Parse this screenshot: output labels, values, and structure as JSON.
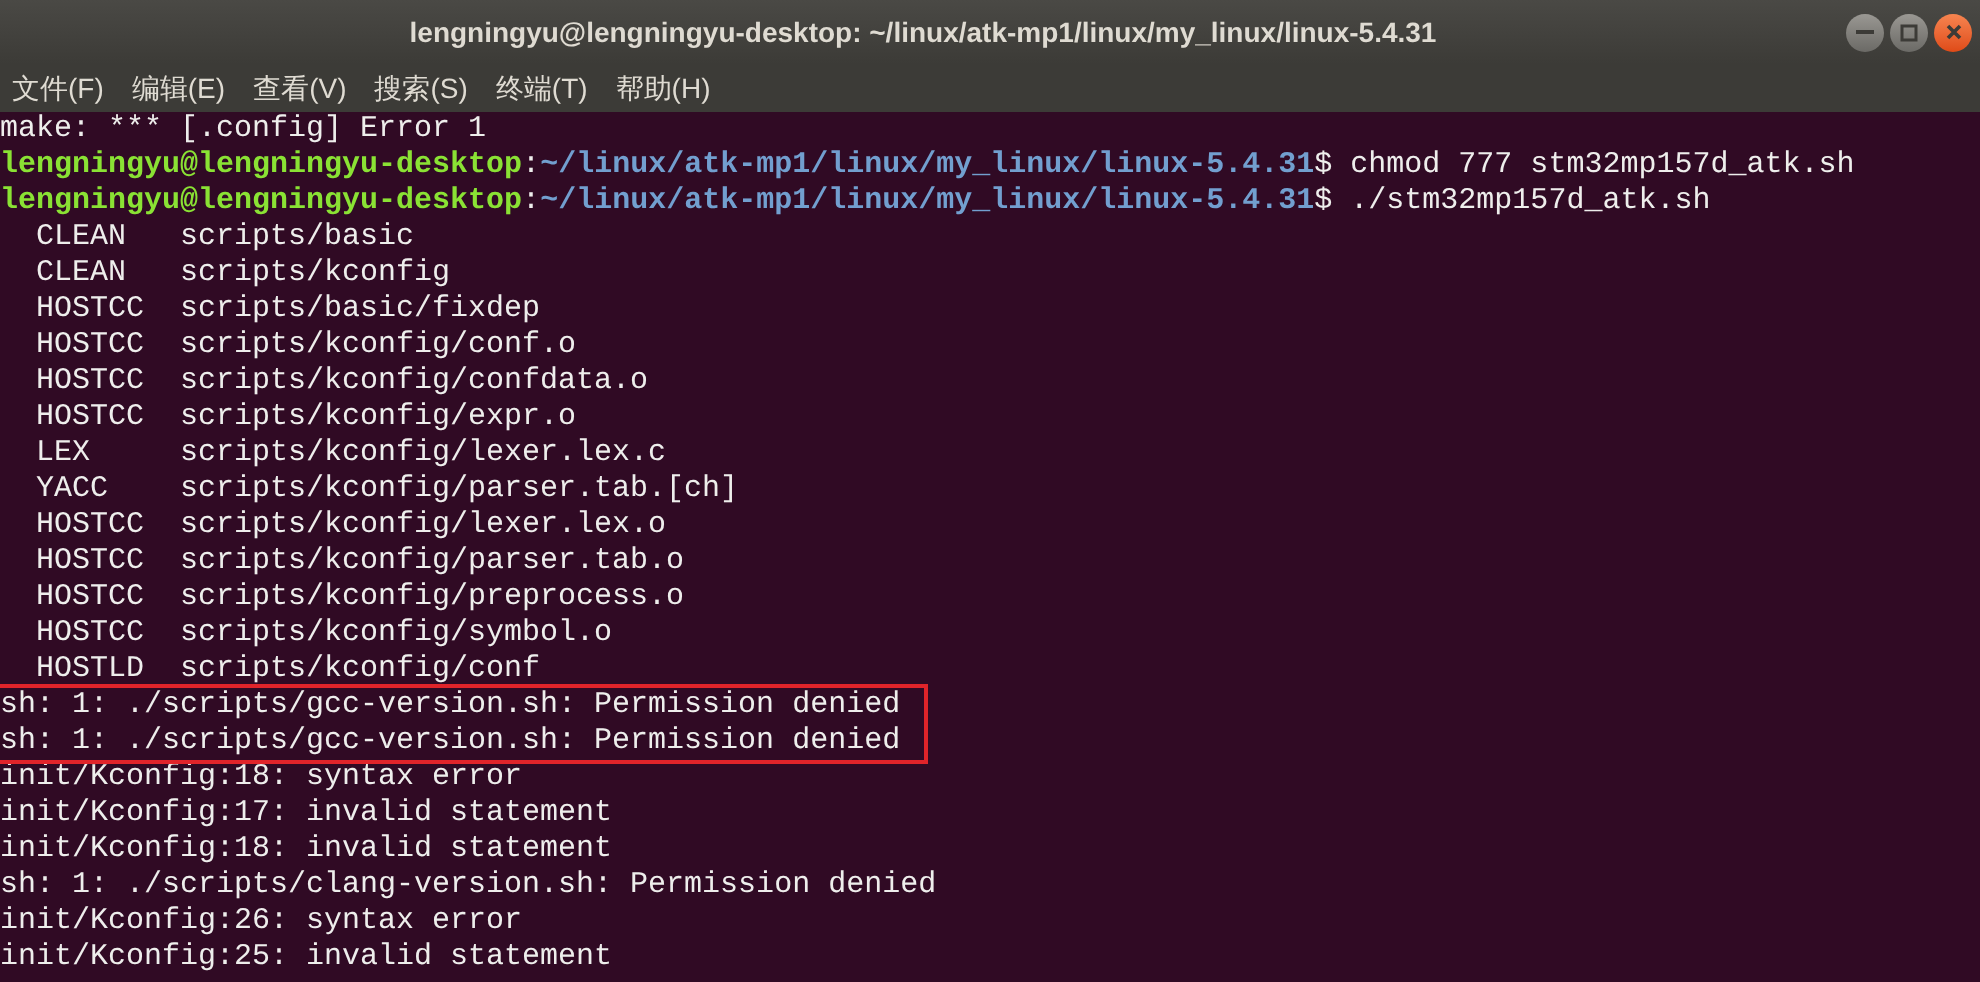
{
  "window": {
    "title": "lengningyu@lengningyu-desktop: ~/linux/atk-mp1/linux/my_linux/linux-5.4.31"
  },
  "menu": [
    "文件(F)",
    "编辑(E)",
    "查看(V)",
    "搜索(S)",
    "终端(T)",
    "帮助(H)"
  ],
  "lines": [
    {
      "kind": "plain",
      "text": "make: *** [.config] Error 1"
    },
    {
      "kind": "prompt",
      "user": "lengningyu@lengningyu-desktop",
      "separator": ":",
      "path": "~/linux/atk-mp1/linux/my_linux/linux-5.4.31",
      "sign": "$",
      "command": "chmod 777 stm32mp157d_atk.sh"
    },
    {
      "kind": "prompt",
      "user": "lengningyu@lengningyu-desktop",
      "separator": ":",
      "path": "~/linux/atk-mp1/linux/my_linux/linux-5.4.31",
      "sign": "$",
      "command": "./stm32mp157d_atk.sh"
    },
    {
      "kind": "plain",
      "text": "  CLEAN   scripts/basic"
    },
    {
      "kind": "plain",
      "text": "  CLEAN   scripts/kconfig"
    },
    {
      "kind": "plain",
      "text": "  HOSTCC  scripts/basic/fixdep"
    },
    {
      "kind": "plain",
      "text": "  HOSTCC  scripts/kconfig/conf.o"
    },
    {
      "kind": "plain",
      "text": "  HOSTCC  scripts/kconfig/confdata.o"
    },
    {
      "kind": "plain",
      "text": "  HOSTCC  scripts/kconfig/expr.o"
    },
    {
      "kind": "plain",
      "text": "  LEX     scripts/kconfig/lexer.lex.c"
    },
    {
      "kind": "plain",
      "text": "  YACC    scripts/kconfig/parser.tab.[ch]"
    },
    {
      "kind": "plain",
      "text": "  HOSTCC  scripts/kconfig/lexer.lex.o"
    },
    {
      "kind": "plain",
      "text": "  HOSTCC  scripts/kconfig/parser.tab.o"
    },
    {
      "kind": "plain",
      "text": "  HOSTCC  scripts/kconfig/preprocess.o"
    },
    {
      "kind": "plain",
      "text": "  HOSTCC  scripts/kconfig/symbol.o"
    },
    {
      "kind": "plain",
      "text": "  HOSTLD  scripts/kconfig/conf"
    },
    {
      "kind": "highlight_box",
      "lines": [
        {
          "kind": "plain",
          "text": "sh: 1: ./scripts/gcc-version.sh: Permission denied"
        },
        {
          "kind": "plain",
          "text": "sh: 1: ./scripts/gcc-version.sh: Permission denied"
        }
      ]
    },
    {
      "kind": "plain",
      "text": "init/Kconfig:18: syntax error"
    },
    {
      "kind": "plain",
      "text": "init/Kconfig:17: invalid statement"
    },
    {
      "kind": "plain",
      "text": "init/Kconfig:18: invalid statement"
    },
    {
      "kind": "plain",
      "text": "sh: 1: ./scripts/clang-version.sh: Permission denied"
    },
    {
      "kind": "plain",
      "text": "init/Kconfig:26: syntax error"
    },
    {
      "kind": "plain",
      "text": "init/Kconfig:25: invalid statement"
    }
  ]
}
